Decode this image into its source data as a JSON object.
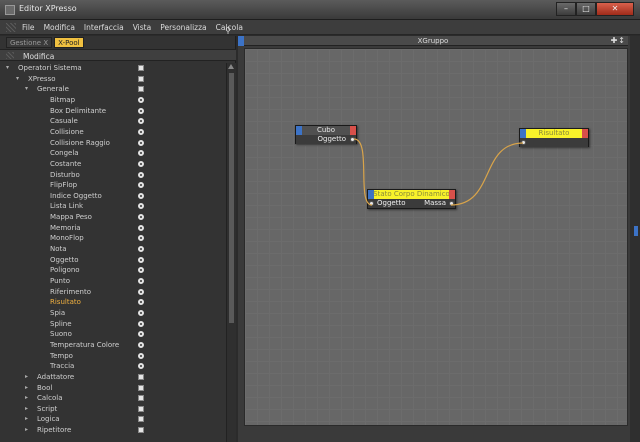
{
  "window": {
    "title": "Editor XPresso"
  },
  "menu": {
    "items": [
      "File",
      "Modifica",
      "Interfaccia",
      "Vista",
      "Personalizza",
      "Calcola"
    ]
  },
  "left_panel": {
    "tabs": [
      {
        "label": "Gestione X",
        "active": false
      },
      {
        "label": "X-Pool",
        "active": true
      }
    ],
    "header": "Modifica",
    "tree": [
      {
        "label": "Operatori Sistema",
        "depth": 0,
        "arrow": "down",
        "icon": "square"
      },
      {
        "label": "XPresso",
        "depth": 1,
        "arrow": "down",
        "icon": "square"
      },
      {
        "label": "Generale",
        "depth": 2,
        "arrow": "down",
        "icon": "square"
      },
      {
        "label": "Bitmap",
        "depth": 3,
        "icon": "gear"
      },
      {
        "label": "Box Delimitante",
        "depth": 3,
        "icon": "gear"
      },
      {
        "label": "Casuale",
        "depth": 3,
        "icon": "gear"
      },
      {
        "label": "Collisione",
        "depth": 3,
        "icon": "gear"
      },
      {
        "label": "Collisione Raggio",
        "depth": 3,
        "icon": "gear"
      },
      {
        "label": "Congela",
        "depth": 3,
        "icon": "gear"
      },
      {
        "label": "Costante",
        "depth": 3,
        "icon": "gear"
      },
      {
        "label": "Disturbo",
        "depth": 3,
        "icon": "gear"
      },
      {
        "label": "FlipFlop",
        "depth": 3,
        "icon": "gear"
      },
      {
        "label": "Indice Oggetto",
        "depth": 3,
        "icon": "gear"
      },
      {
        "label": "Lista Link",
        "depth": 3,
        "icon": "gear"
      },
      {
        "label": "Mappa Peso",
        "depth": 3,
        "icon": "gear"
      },
      {
        "label": "Memoria",
        "depth": 3,
        "icon": "gear"
      },
      {
        "label": "MonoFlop",
        "depth": 3,
        "icon": "gear"
      },
      {
        "label": "Nota",
        "depth": 3,
        "icon": "gear"
      },
      {
        "label": "Oggetto",
        "depth": 3,
        "icon": "gear"
      },
      {
        "label": "Poligono",
        "depth": 3,
        "icon": "gear"
      },
      {
        "label": "Punto",
        "depth": 3,
        "icon": "gear"
      },
      {
        "label": "Riferimento",
        "depth": 3,
        "icon": "gear"
      },
      {
        "label": "Risultato",
        "depth": 3,
        "icon": "gear",
        "highlighted": true
      },
      {
        "label": "Spia",
        "depth": 3,
        "icon": "gear"
      },
      {
        "label": "Spline",
        "depth": 3,
        "icon": "gear"
      },
      {
        "label": "Suono",
        "depth": 3,
        "icon": "gear"
      },
      {
        "label": "Temperatura Colore",
        "depth": 3,
        "icon": "gear"
      },
      {
        "label": "Tempo",
        "depth": 3,
        "icon": "gear"
      },
      {
        "label": "Traccia",
        "depth": 3,
        "icon": "gear"
      },
      {
        "label": "Adattatore",
        "depth": 2,
        "arrow": "right",
        "icon": "square"
      },
      {
        "label": "Bool",
        "depth": 2,
        "arrow": "right",
        "icon": "square"
      },
      {
        "label": "Calcola",
        "depth": 2,
        "arrow": "right",
        "icon": "square"
      },
      {
        "label": "Script",
        "depth": 2,
        "arrow": "right",
        "icon": "square"
      },
      {
        "label": "Logica",
        "depth": 2,
        "arrow": "right",
        "icon": "square"
      },
      {
        "label": "Ripetitore",
        "depth": 2,
        "arrow": "right",
        "icon": "square"
      }
    ]
  },
  "xgroup": {
    "title": "XGruppo",
    "nodes": {
      "cubo": {
        "title": "Cubo",
        "output": "Oggetto"
      },
      "dyn": {
        "title": "Stato Corpo Dinamico",
        "input": "Oggetto",
        "output": "Massa"
      },
      "res": {
        "title": "Risultato"
      }
    }
  },
  "colors": {
    "accent_tab": "#f0c040",
    "highlight_item": "#f0b040",
    "wire": "#d9a44a",
    "node_title_yellow": "#f8f22a"
  }
}
